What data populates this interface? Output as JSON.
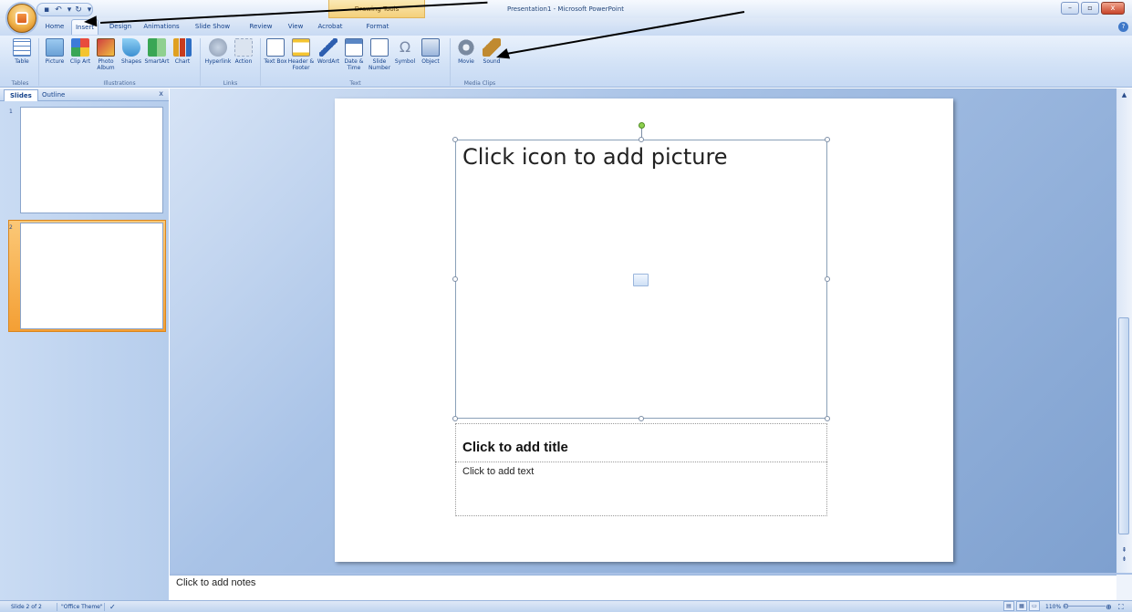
{
  "window": {
    "title": "Presentation1 - Microsoft PowerPoint",
    "contextual_tab_group": "Drawing Tools",
    "controls": {
      "minimize": "–",
      "restore": "▫",
      "close": "x"
    }
  },
  "tabs": [
    {
      "label": "Home"
    },
    {
      "label": "Insert"
    },
    {
      "label": "Design"
    },
    {
      "label": "Animations"
    },
    {
      "label": "Slide Show"
    },
    {
      "label": "Review"
    },
    {
      "label": "View"
    },
    {
      "label": "Acrobat"
    },
    {
      "label": "Format"
    }
  ],
  "ribbon": {
    "buttons": [
      {
        "label": "Table",
        "icon": "table-icon"
      },
      {
        "label": "Picture",
        "icon": "picture-icon"
      },
      {
        "label": "Clip Art",
        "icon": "clip-art-icon"
      },
      {
        "label": "Photo Album",
        "icon": "photo-album-icon"
      },
      {
        "label": "Shapes",
        "icon": "shapes-icon"
      },
      {
        "label": "SmartArt",
        "icon": "smartart-icon"
      },
      {
        "label": "Chart",
        "icon": "chart-icon"
      },
      {
        "label": "Hyperlink",
        "icon": "hyperlink-icon"
      },
      {
        "label": "Action",
        "icon": "action-icon"
      },
      {
        "label": "Text Box",
        "icon": "text-box-icon"
      },
      {
        "label": "Header & Footer",
        "icon": "header-footer-icon"
      },
      {
        "label": "WordArt",
        "icon": "wordart-icon"
      },
      {
        "label": "Date & Time",
        "icon": "date-time-icon"
      },
      {
        "label": "Slide Number",
        "icon": "slide-number-icon"
      },
      {
        "label": "Symbol",
        "icon": "symbol-icon"
      },
      {
        "label": "Object",
        "icon": "object-icon"
      },
      {
        "label": "Movie",
        "icon": "movie-icon"
      },
      {
        "label": "Sound",
        "icon": "sound-icon"
      }
    ],
    "groups": [
      "Tables",
      "Illustrations",
      "Links",
      "Text",
      "Media Clips"
    ]
  },
  "left_panel": {
    "tabs": [
      "Slides",
      "Outline"
    ],
    "close": "x",
    "thumbnails": [
      {
        "number": "1"
      },
      {
        "number": "2"
      }
    ]
  },
  "slide": {
    "picture_placeholder": "Click icon to add picture",
    "title_placeholder": "Click to add title",
    "text_placeholder": "Click to add text"
  },
  "notes": {
    "placeholder": "Click to add notes"
  },
  "status": {
    "slide_info": "Slide 2 of 2",
    "theme": "\"Office Theme\"",
    "zoom": "110%"
  },
  "colors": {
    "accent": "#15428b",
    "selection": "#f49f34",
    "rotation_handle": "#8ed14f"
  }
}
